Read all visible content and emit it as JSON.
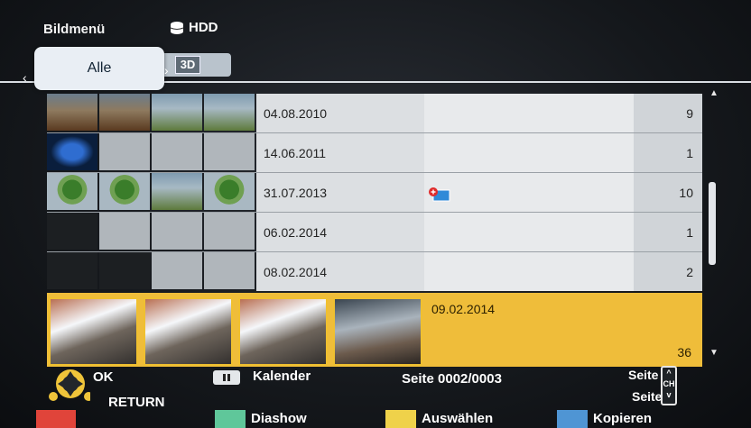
{
  "header": {
    "title": "Bildmenü",
    "source": "HDD",
    "tabs": [
      {
        "label": "Alle"
      },
      {
        "label": "3D"
      }
    ]
  },
  "rows": [
    {
      "date": "04.08.2010",
      "count": "9"
    },
    {
      "date": "14.06.2011",
      "count": "1"
    },
    {
      "date": "31.07.2013",
      "count": "10"
    },
    {
      "date": "06.02.2014",
      "count": "1"
    },
    {
      "date": "08.02.2014",
      "count": "2"
    }
  ],
  "selected": {
    "date": "09.02.2014",
    "count": "36"
  },
  "footer": {
    "ok_label": "OK",
    "return_label": "RETURN",
    "calendar_label": "Kalender",
    "page_label": "Seite 0002/0003",
    "page_plus": "Seite +",
    "page_minus": "Seite -",
    "ch_label": "CH",
    "green_label": "Diashow",
    "yellow_label": "Auswählen",
    "blue_label": "Kopieren"
  },
  "colors": {
    "selected_row": "#efbd3a",
    "red": "#e0443a",
    "green": "#5fc79a",
    "yellow": "#efd24a",
    "blue": "#4f95d4"
  }
}
